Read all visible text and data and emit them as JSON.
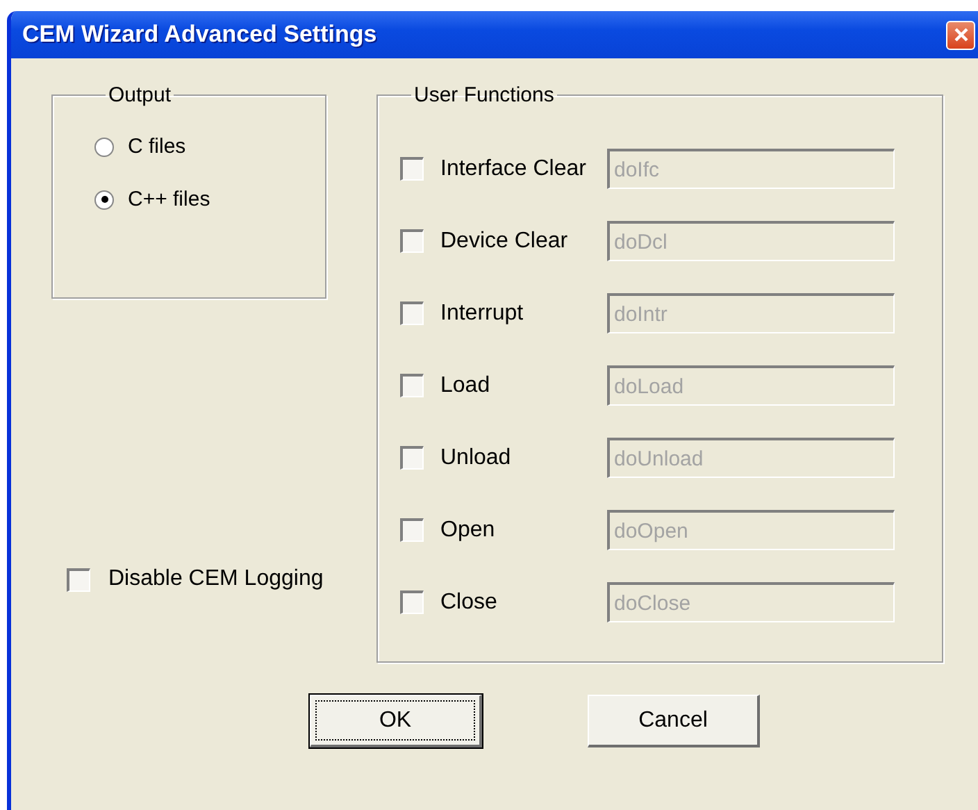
{
  "window": {
    "title": "CEM Wizard Advanced Settings"
  },
  "output": {
    "title": "Output",
    "options": [
      {
        "label": "C files",
        "selected": false
      },
      {
        "label": "C++ files",
        "selected": true
      }
    ]
  },
  "disable_logging": {
    "label": "Disable CEM Logging",
    "checked": false
  },
  "user_functions": {
    "title": "User Functions",
    "items": [
      {
        "label": "Interface Clear",
        "checked": false,
        "value": "doIfc",
        "disabled": true
      },
      {
        "label": "Device Clear",
        "checked": false,
        "value": "doDcl",
        "disabled": true
      },
      {
        "label": "Interrupt",
        "checked": false,
        "value": "doIntr",
        "disabled": true
      },
      {
        "label": "Load",
        "checked": false,
        "value": "doLoad",
        "disabled": true
      },
      {
        "label": "Unload",
        "checked": false,
        "value": "doUnload",
        "disabled": true
      },
      {
        "label": "Open",
        "checked": false,
        "value": "doOpen",
        "disabled": true
      },
      {
        "label": "Close",
        "checked": false,
        "value": "doClose",
        "disabled": true
      }
    ]
  },
  "buttons": [
    {
      "label": "OK",
      "default": true
    },
    {
      "label": "Cancel",
      "default": false
    }
  ]
}
